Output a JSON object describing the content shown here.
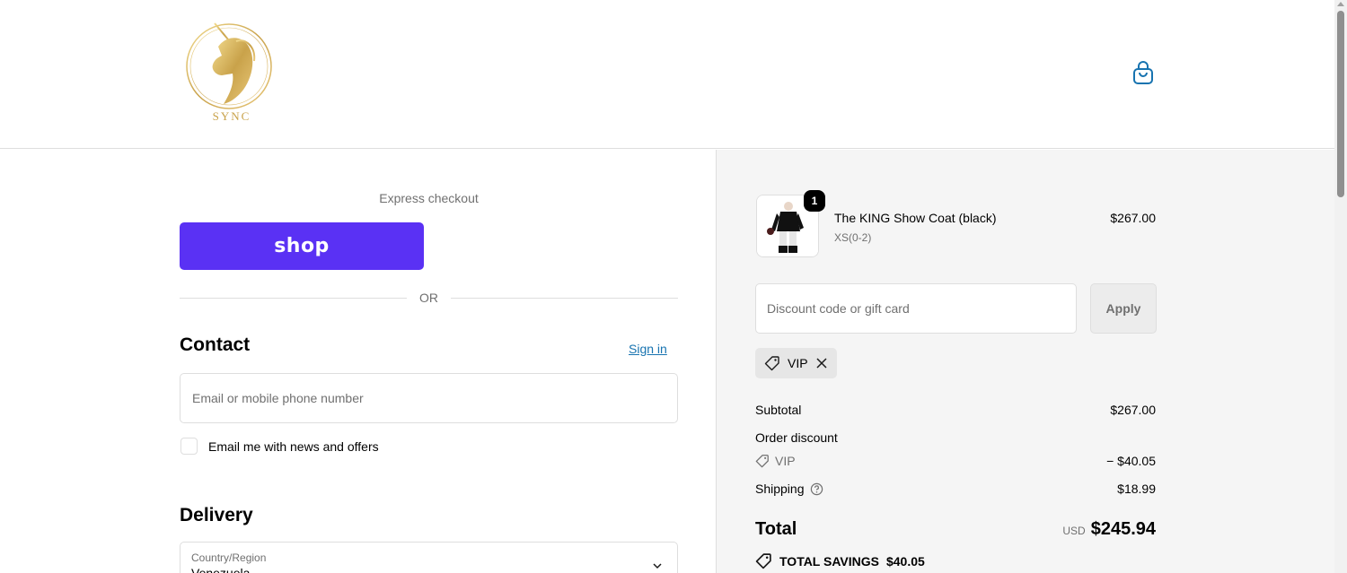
{
  "brand": {
    "name": "SYNC"
  },
  "express": {
    "title": "Express checkout",
    "shop_label": "shop",
    "or_label": "OR"
  },
  "contact": {
    "heading": "Contact",
    "sign_in": "Sign in",
    "email_placeholder": "Email or mobile phone number",
    "news_label": "Email me with news and offers"
  },
  "delivery": {
    "heading": "Delivery",
    "country_label": "Country/Region",
    "country_value": "Venezuela"
  },
  "cart": {
    "items": [
      {
        "name": "The KING Show Coat (black)",
        "variant": "XS(0-2)",
        "price": "$267.00",
        "quantity": "1"
      }
    ]
  },
  "discount": {
    "placeholder": "Discount code or gift card",
    "apply_label": "Apply",
    "applied_code": "VIP"
  },
  "summary": {
    "subtotal_label": "Subtotal",
    "subtotal_value": "$267.00",
    "order_discount_label": "Order discount",
    "discount_code": "VIP",
    "discount_value": "− $40.05",
    "shipping_label": "Shipping",
    "shipping_value": "$18.99",
    "total_label": "Total",
    "currency": "USD",
    "total_value": "$245.94",
    "savings_label": "TOTAL SAVINGS",
    "savings_value": "$40.05"
  },
  "colors": {
    "shop_purple": "#5a31f4",
    "link_blue": "#1773b0",
    "gold": "#c9a24a"
  }
}
